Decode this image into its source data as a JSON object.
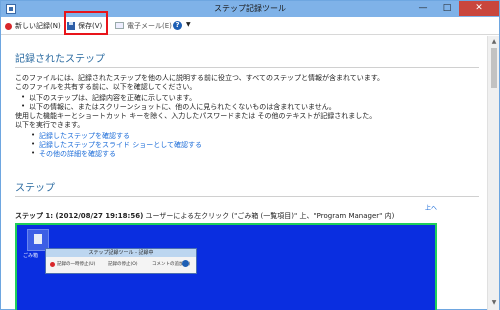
{
  "window": {
    "title": "ステップ記録ツール",
    "controls": {
      "minimize": "—",
      "maximize": "□",
      "close": "✕"
    }
  },
  "toolbar": {
    "new_record_label": "新しい記録(N)",
    "save_label": "保存(V)",
    "email_label": "電子メール(E)",
    "help_icon_glyph": "?",
    "help_caret": "▼"
  },
  "content": {
    "recorded_steps_heading": "記録されたステップ",
    "intro_line1": "このファイルには、記録されたステップを他の人に説明する前に役立つ、すべてのステップと情報が含まれています。",
    "intro_line2": "このファイルを共有する前に、以下を確認してください。",
    "bullets": [
      "以下のステップは、記録内容を正確に示しています。",
      "以下の情報に、またはスクリーンショットに、他の人に見られたくないものは含まれていません。"
    ],
    "note_line1": "使用した機能キーとショートカット キーを除く、入力したパスワードまたは その他のテキストが記録されました。",
    "note_line2": "以下を実行できます。",
    "links": [
      "記録したステップを確認する",
      "記録したステップをスライド ショーとして確認する",
      "その他の詳細を確認する"
    ],
    "steps_heading": "ステップ",
    "top_link": "上へ",
    "step1_prefix": "ステップ 1: (2012/08/27 19:18:56)",
    "step1_text": " ユーザーによる左クリック (\"ごみ箱 (一覧項目)\" 上、\"Program Manager\" 内)"
  },
  "screenshot": {
    "icon_label": "ごみ箱",
    "mini_title": "ステップ記録ツール - 記録中",
    "mini_pause": "記録の一時停止(U)",
    "mini_stop": "記録の停止(O)",
    "mini_comment": "コメントの追加(C)"
  },
  "colors": {
    "titlebar": "#7fb2e8",
    "heading": "#2a6aa0",
    "link": "#1a6bd8",
    "highlight_box": "#e8141a",
    "screenshot_bg": "#0a2ee0",
    "screenshot_border": "#1fcf5a"
  }
}
